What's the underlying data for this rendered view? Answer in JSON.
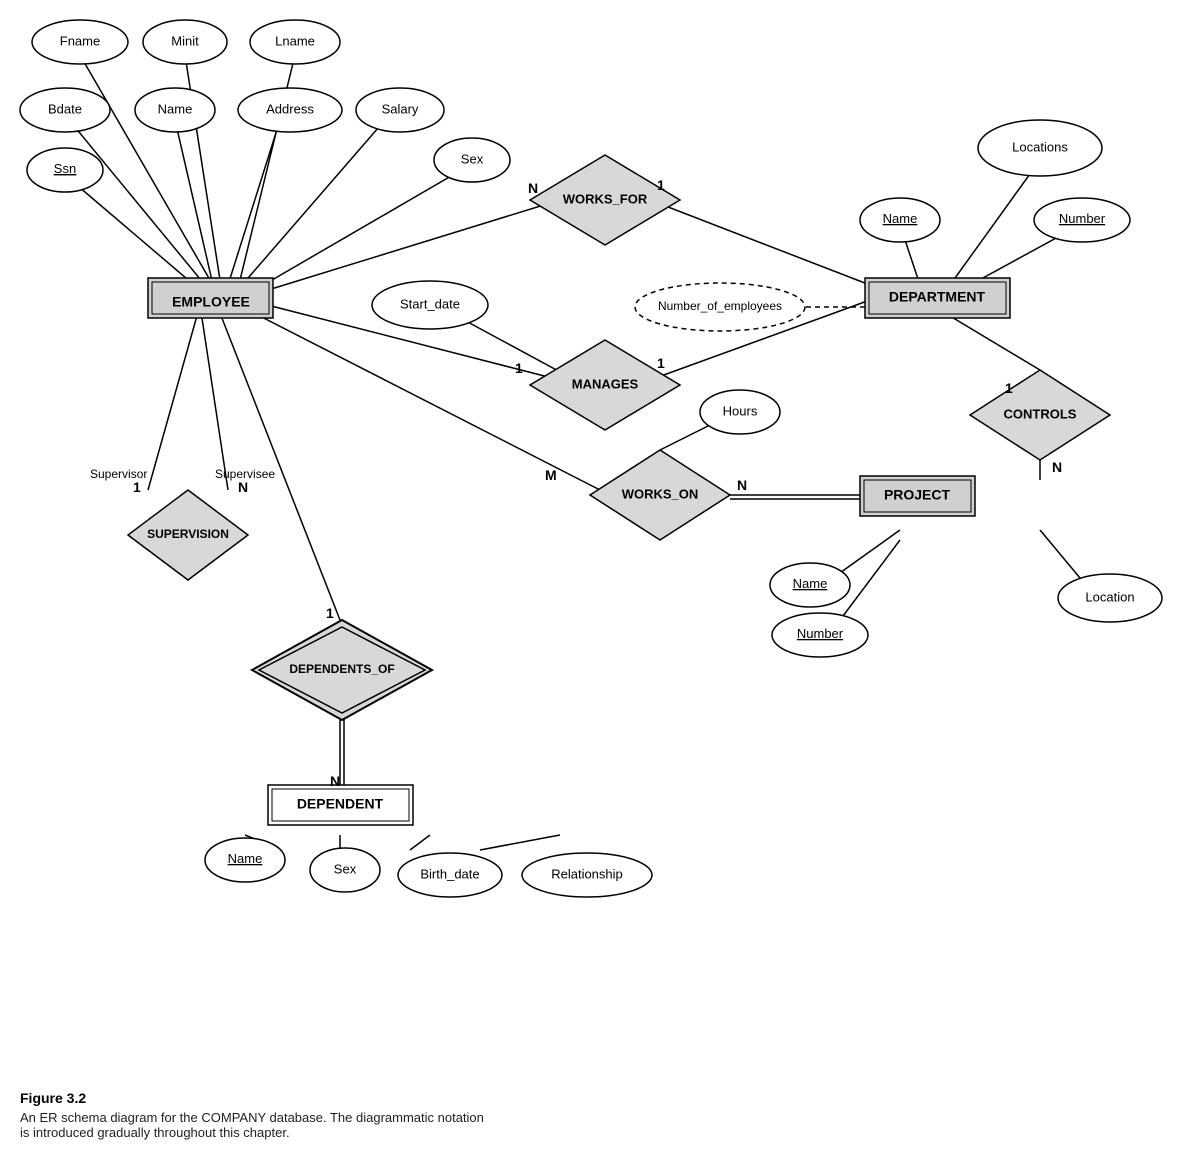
{
  "diagram": {
    "title": "Figure 3.2",
    "caption_line1": "An ER schema diagram for the COMPANY database. The diagrammatic notation",
    "caption_line2": "is introduced gradually throughout this chapter."
  },
  "entities": {
    "employee": "EMPLOYEE",
    "department": "DEPARTMENT",
    "project": "PROJECT",
    "dependent": "DEPENDENT"
  },
  "relationships": {
    "works_for": "WORKS_FOR",
    "manages": "MANAGES",
    "works_on": "WORKS_ON",
    "controls": "CONTROLS",
    "supervision": "SUPERVISION",
    "dependents_of": "DEPENDENTS_OF"
  },
  "attributes": {
    "fname": "Fname",
    "minit": "Minit",
    "lname": "Lname",
    "bdate": "Bdate",
    "name_emp": "Name",
    "address": "Address",
    "salary": "Salary",
    "ssn": "Ssn",
    "sex_emp": "Sex",
    "start_date": "Start_date",
    "num_employees": "Number_of_employees",
    "locations": "Locations",
    "dept_name": "Name",
    "dept_number": "Number",
    "hours": "Hours",
    "proj_name": "Name",
    "proj_number": "Number",
    "location": "Location",
    "dep_name": "Name",
    "dep_sex": "Sex",
    "birth_date": "Birth_date",
    "relationship": "Relationship"
  },
  "cardinalities": {
    "works_for_n": "N",
    "works_for_1": "1",
    "manages_1a": "1",
    "manages_1b": "1",
    "works_on_m": "M",
    "works_on_n": "N",
    "controls_1": "1",
    "controls_n": "N",
    "supervision_1": "1",
    "supervision_n": "N",
    "dependents_of_1": "1",
    "dependents_of_n": "N"
  }
}
